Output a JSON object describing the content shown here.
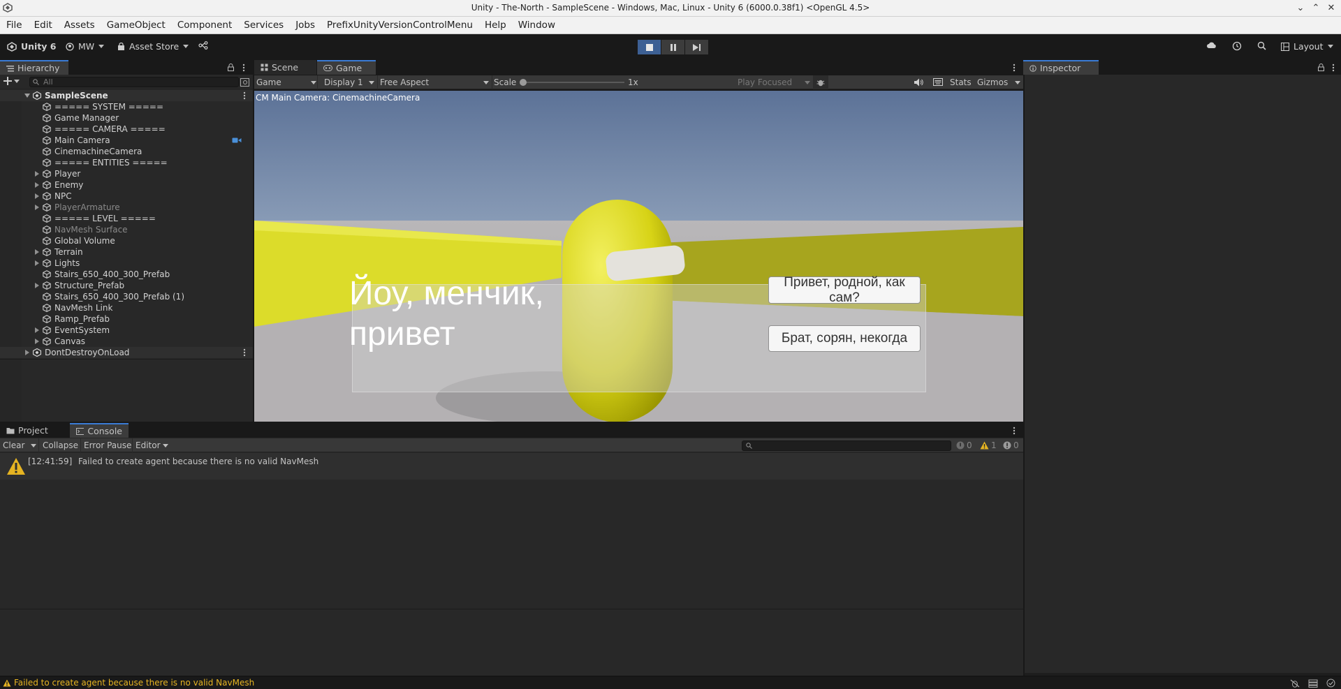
{
  "window": {
    "title": "Unity - The-North - SampleScene - Windows, Mac, Linux - Unity 6 (6000.0.38f1) <OpenGL 4.5>"
  },
  "menubar": [
    "File",
    "Edit",
    "Assets",
    "GameObject",
    "Component",
    "Services",
    "Jobs",
    "PrefixUnityVersionControlMenu",
    "Help",
    "Window"
  ],
  "toolbar": {
    "unity_label": "Unity 6",
    "account_label": "MW",
    "asset_store_label": "Asset Store",
    "layout_label": "Layout"
  },
  "hierarchy": {
    "tab_label": "Hierarchy",
    "search_placeholder": "All",
    "scene_name": "SampleScene",
    "items": [
      {
        "label": "===== SYSTEM =====",
        "expandable": false,
        "dim": false
      },
      {
        "label": "Game Manager",
        "expandable": false,
        "dim": false
      },
      {
        "label": "===== CAMERA =====",
        "expandable": false,
        "dim": false
      },
      {
        "label": "Main Camera",
        "expandable": false,
        "dim": false
      },
      {
        "label": "CinemachineCamera",
        "expandable": false,
        "dim": false
      },
      {
        "label": "===== ENTITIES =====",
        "expandable": false,
        "dim": false
      },
      {
        "label": "Player",
        "expandable": true,
        "dim": false
      },
      {
        "label": "Enemy",
        "expandable": true,
        "dim": false
      },
      {
        "label": "NPC",
        "expandable": true,
        "dim": false
      },
      {
        "label": "PlayerArmature",
        "expandable": true,
        "dim": true
      },
      {
        "label": "===== LEVEL =====",
        "expandable": false,
        "dim": false
      },
      {
        "label": "NavMesh Surface",
        "expandable": false,
        "dim": true
      },
      {
        "label": "Global Volume",
        "expandable": false,
        "dim": false
      },
      {
        "label": "Terrain",
        "expandable": true,
        "dim": false
      },
      {
        "label": "Lights",
        "expandable": true,
        "dim": false
      },
      {
        "label": "Stairs_650_400_300_Prefab",
        "expandable": false,
        "dim": false
      },
      {
        "label": "Structure_Prefab",
        "expandable": true,
        "dim": false
      },
      {
        "label": "Stairs_650_400_300_Prefab (1)",
        "expandable": false,
        "dim": false
      },
      {
        "label": "NavMesh Link",
        "expandable": false,
        "dim": false
      },
      {
        "label": "Ramp_Prefab",
        "expandable": false,
        "dim": false
      },
      {
        "label": "EventSystem",
        "expandable": true,
        "dim": false
      },
      {
        "label": "Canvas",
        "expandable": true,
        "dim": false
      }
    ],
    "dont_destroy_label": "DontDestroyOnLoad"
  },
  "gameview": {
    "tabs": {
      "scene": "Scene",
      "game": "Game"
    },
    "controls": {
      "mode": "Game",
      "display": "Display 1",
      "aspect": "Free Aspect",
      "scale_label": "Scale",
      "scale_value": "1x",
      "play_focused": "Play Focused",
      "stats": "Stats",
      "gizmos": "Gizmos"
    },
    "camera_label": "CM Main Camera: CinemachineCamera",
    "dialog_text": "Йоу, менчик, привет",
    "choice_1": "Привет, родной, как сам?",
    "choice_2": "Брат, сорян, некогда"
  },
  "inspector": {
    "tab_label": "Inspector"
  },
  "console": {
    "tabs": {
      "project": "Project",
      "console": "Console"
    },
    "buttons": {
      "clear": "Clear",
      "collapse": "Collapse",
      "error_pause": "Error Pause",
      "editor": "Editor"
    },
    "counts": {
      "info": "0",
      "warnings": "1",
      "errors": "0"
    },
    "entries": [
      {
        "time": "[12:41:59]",
        "message": "Failed to create agent because there is no valid NavMesh",
        "type": "warning"
      }
    ]
  },
  "statusbar": {
    "message": "Failed to create agent because there is no valid NavMesh"
  },
  "colors": {
    "accent": "#3a7bd5",
    "warning": "#e6b422",
    "play_active": "#3d6094",
    "character": "#d9d400"
  }
}
